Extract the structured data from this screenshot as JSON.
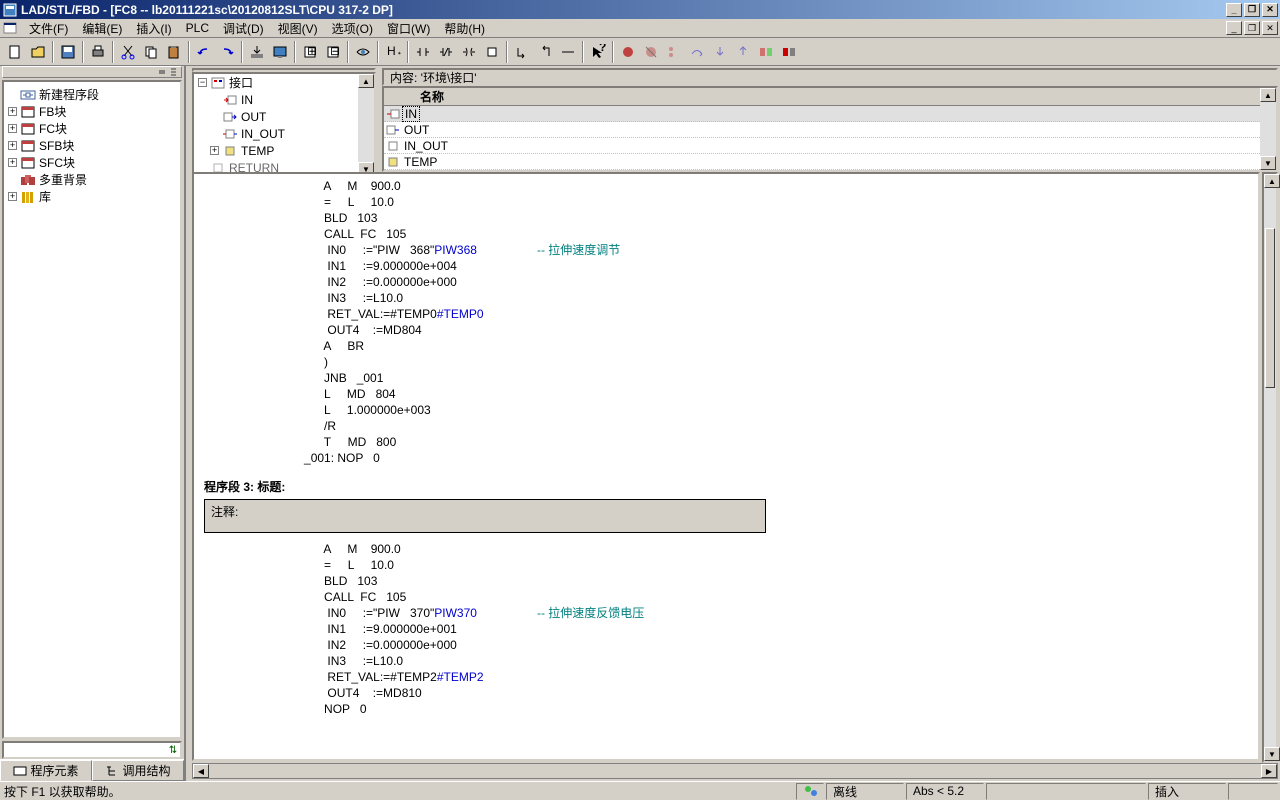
{
  "window": {
    "title": "LAD/STL/FBD  - [FC8 -- lb20111221sc\\20120812SLT\\CPU 317-2 DP]"
  },
  "menu": {
    "file": "文件(F)",
    "edit": "编辑(E)",
    "insert": "插入(I)",
    "plc": "PLC",
    "debug": "调试(D)",
    "view": "视图(V)",
    "options": "选项(O)",
    "window": "窗口(W)",
    "help": "帮助(H)"
  },
  "left_tree": {
    "new_segment": "新建程序段",
    "fb": "FB块",
    "fc": "FC块",
    "sfb": "SFB块",
    "sfc": "SFC块",
    "multi_bg": "多重背景",
    "lib": "库"
  },
  "left_tabs": {
    "elements": "程序元素",
    "callstruct": "调用结构"
  },
  "interface": {
    "root": "接口",
    "in": "IN",
    "out": "OUT",
    "in_out": "IN_OUT",
    "temp": "TEMP",
    "return": "RETURN"
  },
  "content_label": "内容:    '环境\\接口'",
  "name_header": "名称",
  "name_rows": [
    "IN",
    "OUT",
    "IN_OUT",
    "TEMP"
  ],
  "code": {
    "block1": [
      "      A     M    900.0",
      "      =     L     10.0",
      "      BLD   103",
      "      CALL  FC   105"
    ],
    "block1_params": [
      {
        "lhs": "       IN0     :=\"PIW   368\"",
        "ref": "PIW368",
        "comment": "-- 拉伸速度调节"
      },
      {
        "lhs": "       IN1     :=9.000000e+004",
        "ref": "",
        "comment": ""
      },
      {
        "lhs": "       IN2     :=0.000000e+000",
        "ref": "",
        "comment": ""
      },
      {
        "lhs": "       IN3     :=L10.0",
        "ref": "",
        "comment": ""
      },
      {
        "lhs": "       RET_VAL:=#TEMP0",
        "ref": "#TEMP0",
        "comment": ""
      },
      {
        "lhs": "       OUT4    :=MD804",
        "ref": "",
        "comment": ""
      }
    ],
    "block1_tail": [
      "      A     BR",
      "      )",
      "      JNB   _001",
      "      L     MD   804",
      "      L     1.000000e+003",
      "      /R",
      "      T     MD   800",
      "_001: NOP   0"
    ],
    "segment_title": "程序段  3: 标题:",
    "comment_label": "注释:",
    "block2": [
      "      A     M    900.0",
      "      =     L     10.0",
      "      BLD   103",
      "      CALL  FC   105"
    ],
    "block2_params": [
      {
        "lhs": "       IN0     :=\"PIW   370\"",
        "ref": "PIW370",
        "comment": "-- 拉伸速度反馈电压"
      },
      {
        "lhs": "       IN1     :=9.000000e+001",
        "ref": "",
        "comment": ""
      },
      {
        "lhs": "       IN2     :=0.000000e+000",
        "ref": "",
        "comment": ""
      },
      {
        "lhs": "       IN3     :=L10.0",
        "ref": "",
        "comment": ""
      },
      {
        "lhs": "       RET_VAL:=#TEMP2",
        "ref": "#TEMP2",
        "comment": ""
      },
      {
        "lhs": "       OUT4    :=MD810",
        "ref": "",
        "comment": ""
      }
    ],
    "block2_tail": [
      "      NOP   0"
    ]
  },
  "status": {
    "hint": "按下 F1 以获取帮助。",
    "sim": "",
    "offline": "离线",
    "abs": "Abs < 5.2",
    "insert": "插入"
  }
}
